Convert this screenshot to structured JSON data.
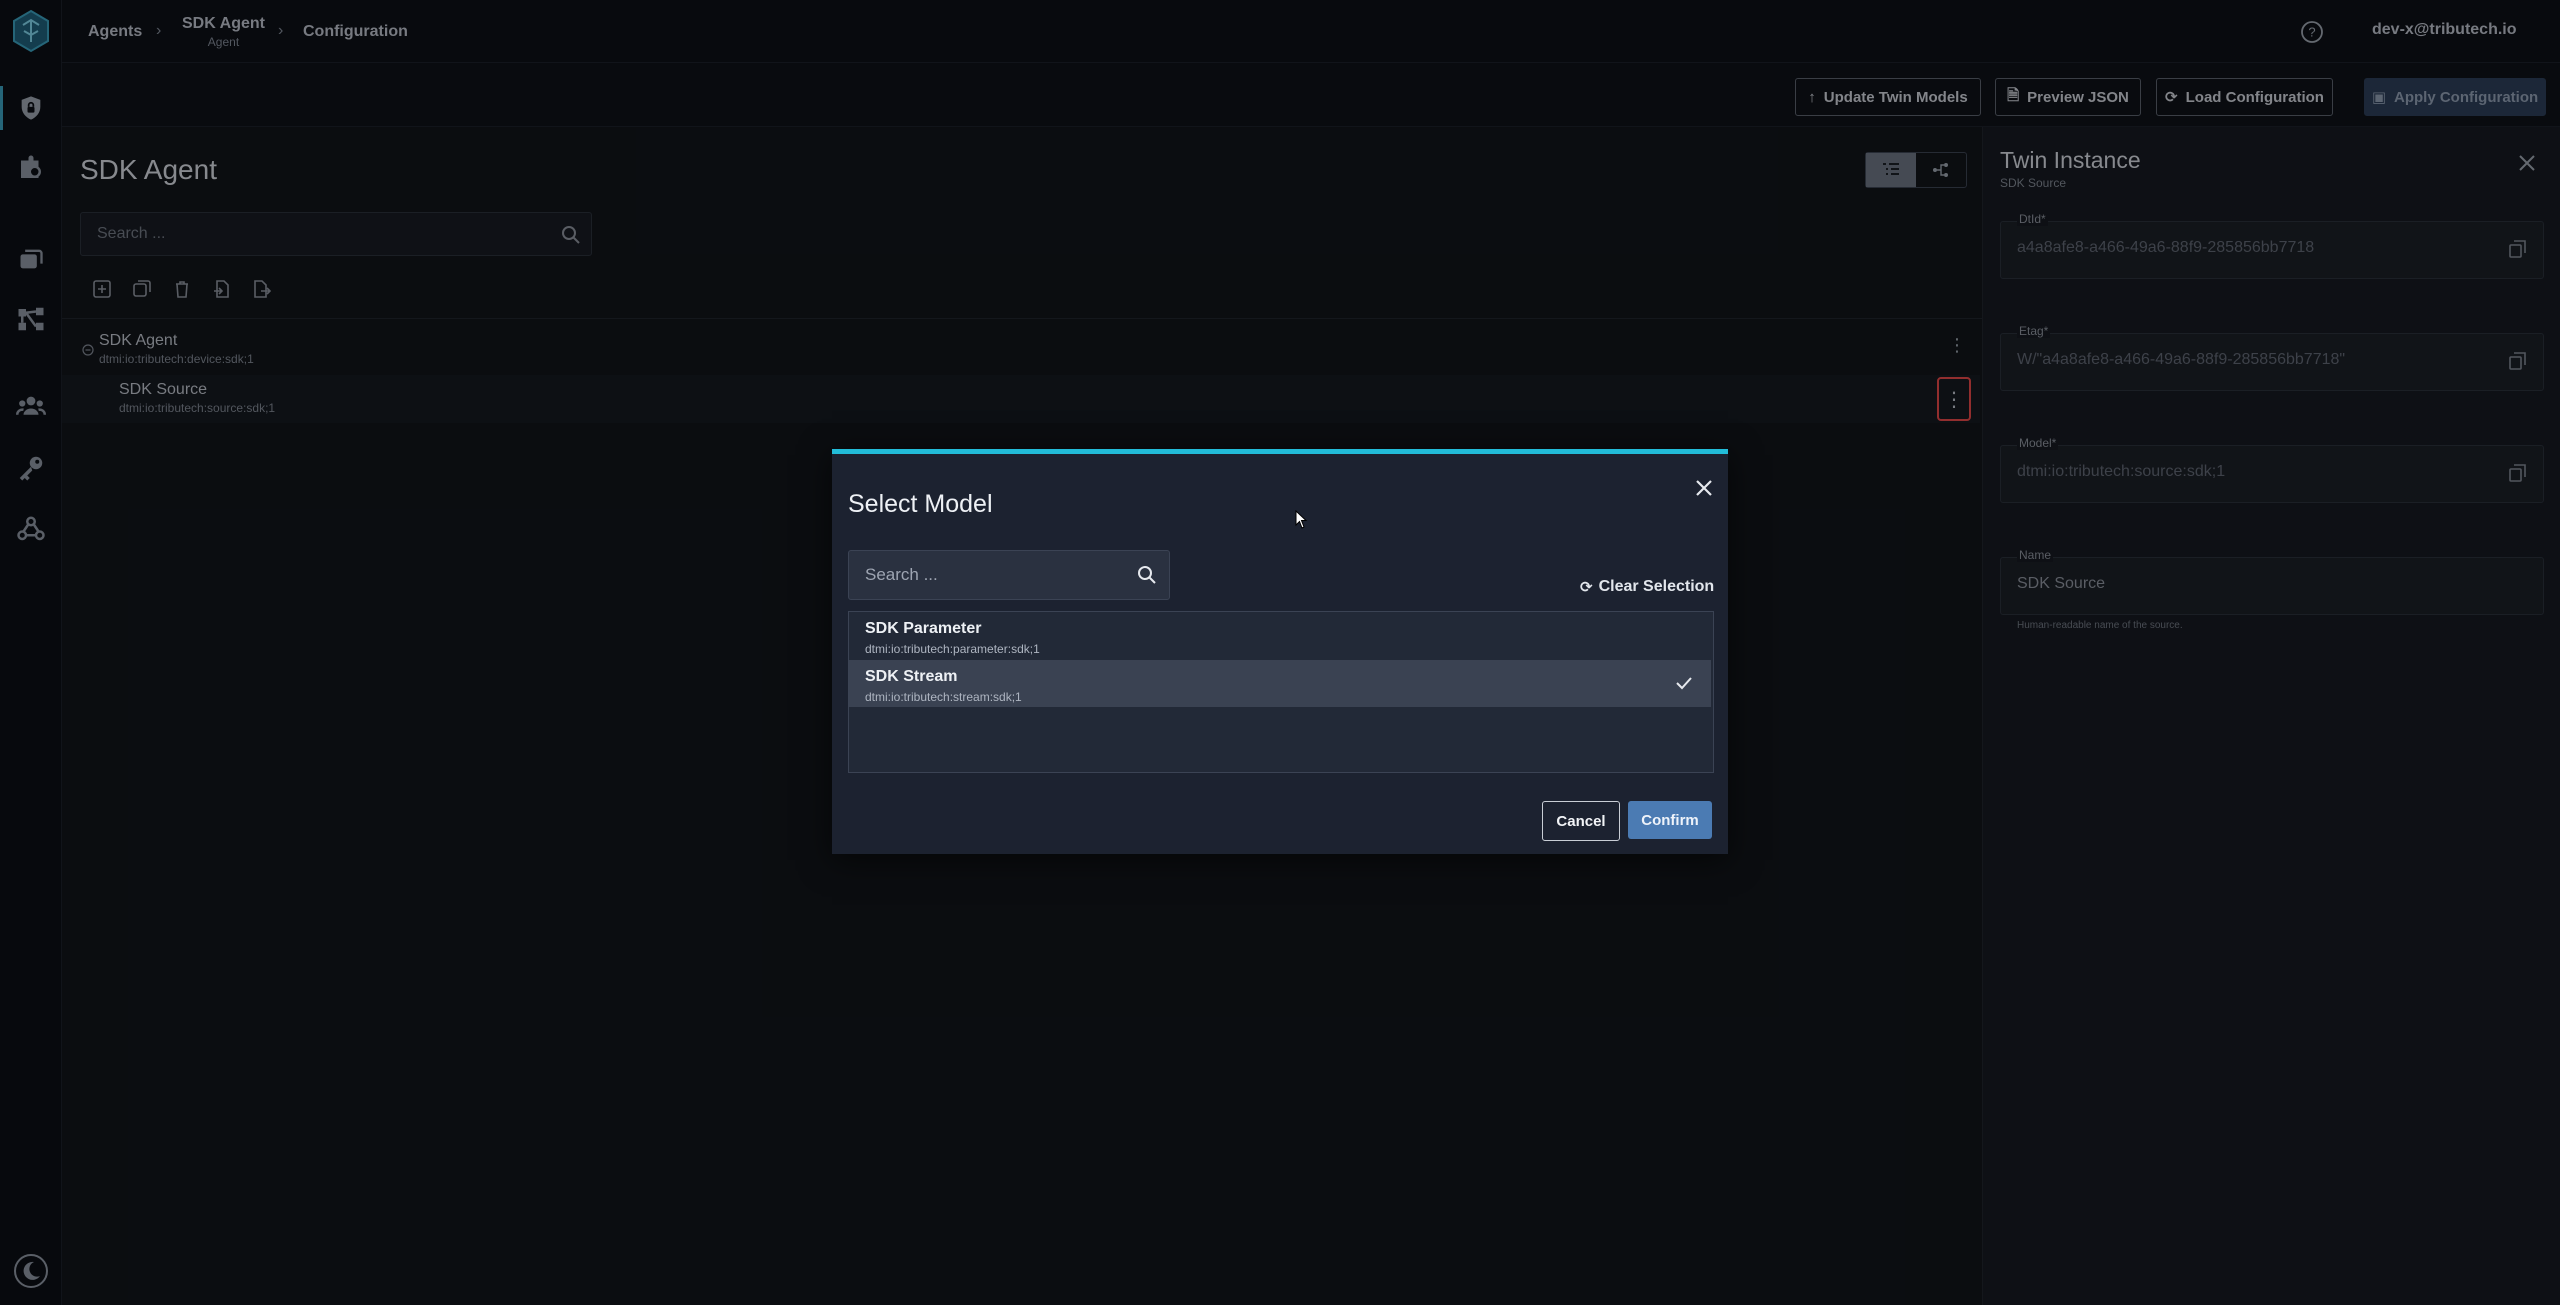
{
  "breadcrumb": {
    "item1": "Agents",
    "item2_title": "SDK Agent",
    "item2_sub": "Agent",
    "item3": "Configuration"
  },
  "user": {
    "email": "dev-x@tributech.io"
  },
  "toolbar": {
    "update_twin_models": "Update Twin Models",
    "preview_json": "Preview JSON",
    "load_configuration": "Load Configuration",
    "apply_configuration": "Apply Configuration"
  },
  "panel": {
    "title": "SDK Agent",
    "search_placeholder": "Search ..."
  },
  "tree": [
    {
      "title": "SDK Agent",
      "sub": "dtmi:io:tributech:device:sdk;1"
    },
    {
      "title": "SDK Source",
      "sub": "dtmi:io:tributech:source:sdk;1"
    }
  ],
  "twin": {
    "title": "Twin Instance",
    "subtitle": "SDK Source",
    "fields": [
      {
        "label": "DtId*",
        "value": "a4a8afe8-a466-49a6-88f9-285856bb7718"
      },
      {
        "label": "Etag*",
        "value": "W/\"a4a8afe8-a466-49a6-88f9-285856bb7718\""
      },
      {
        "label": "Model*",
        "value": "dtmi:io:tributech:source:sdk;1"
      },
      {
        "label": "Name",
        "value": "SDK Source"
      }
    ],
    "name_hint": "Human-readable name of the source."
  },
  "modal": {
    "title": "Select Model",
    "search_placeholder": "Search ...",
    "clear_selection": "Clear Selection",
    "items": [
      {
        "title": "SDK Parameter",
        "sub": "dtmi:io:tributech:parameter:sdk;1",
        "selected": false
      },
      {
        "title": "SDK Stream",
        "sub": "dtmi:io:tributech:stream:sdk;1",
        "selected": true
      }
    ],
    "cancel": "Cancel",
    "confirm": "Confirm"
  },
  "colors": {
    "accent": "#22bcd8",
    "confirm": "#4b7bb3",
    "highlight": "#e04848"
  }
}
